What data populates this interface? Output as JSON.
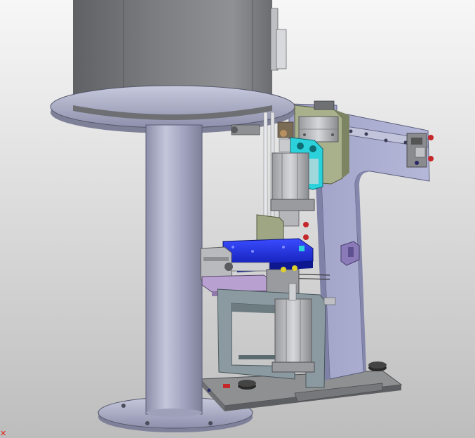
{
  "viewport": {
    "background_top": "#f7f7f7",
    "background_bottom": "#bdbdbd",
    "axis_marker_color": "#e0231b"
  },
  "model": {
    "colors": {
      "steel_dark": "#6e7073",
      "steel_mid": "#9b9c9f",
      "steel_light": "#d0d1d4",
      "frame_lavender": "#a9acd0",
      "frame_lavender_dark": "#7d80a8",
      "block_blue": "#1a2de0",
      "clamp_teal": "#2bd2dc",
      "plate_olive": "#a8b08c",
      "slide_purple": "#b8a0d0",
      "fastener_red": "#c4282a",
      "rubber_black": "#2a2a2a"
    },
    "parts": [
      "cylinder-tank",
      "support-column",
      "top-flange",
      "base-flange",
      "side-frame-plate",
      "top-rail-beam",
      "guide-rod",
      "pneumatic-cylinder-upper",
      "pneumatic-cylinder-lower",
      "clamp-bracket",
      "blue-fixture-block",
      "slide-rail",
      "sliding-carriage",
      "open-frame-bracket",
      "base-plate",
      "leveling-feet"
    ]
  }
}
